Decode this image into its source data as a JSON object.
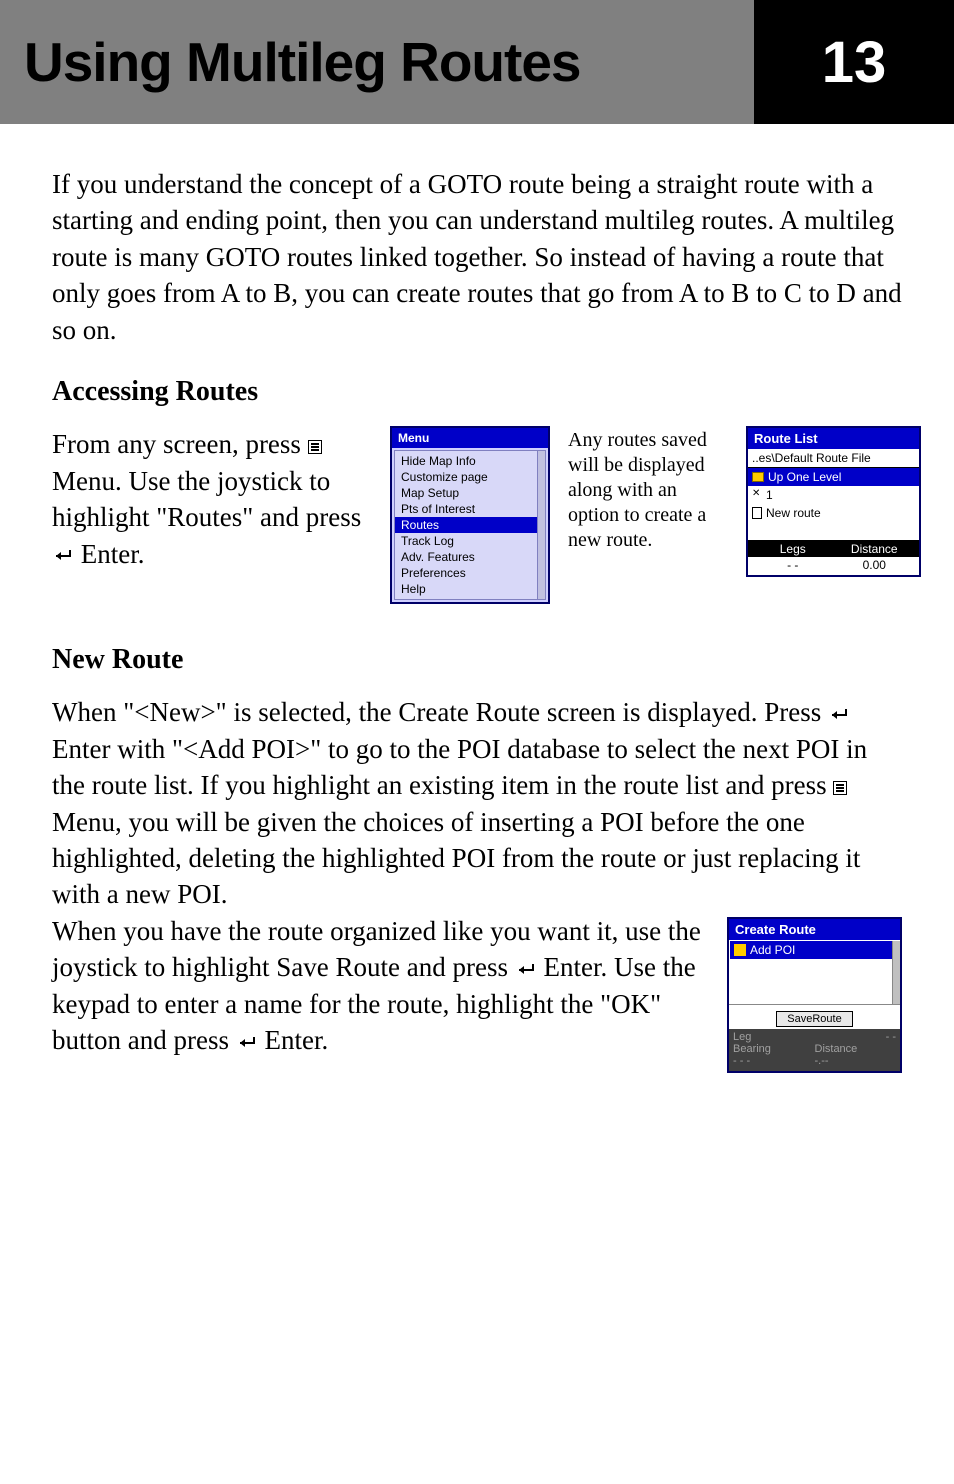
{
  "header": {
    "title": "Using Multileg Routes",
    "chapter": "13"
  },
  "intro": "If you understand the concept of a GOTO route being a straight route with a starting and ending point, then you can understand multileg routes.  A multileg route is many GOTO routes linked together.  So instead of having a route that only goes from A to B, you can create routes that go from A to B to C to D and so on.",
  "sections": {
    "accessing": {
      "title": "Accessing Routes",
      "text_prefix": "From any screen, press ",
      "text_mid1": " Menu.  Use the joystick to highlight \"Routes\" and press ",
      "text_suffix": " Enter.",
      "mid_caption": "Any routes saved will be displayed along with an option to create a new route."
    },
    "new_route": {
      "title": "New Route",
      "p1_a": "When \"<New>\" is selected, the Create Route screen is displayed. Press ",
      "p1_b": " Enter with \"<Add POI>\" to go to the POI database to select the next POI in the route list.  If you highlight an existing item in the route list and press ",
      "p1_c": " Menu, you will be given the choices of inserting a POI before the one highlighted, deleting the highlighted POI from the route or just replacing it with a new POI.",
      "p2_a": "When you have the route organized like you want it, use the joystick to highlight Save Route and press ",
      "p2_b": " Enter.  Use the keypad to enter a name for the route, highlight the \"OK\" button and press ",
      "p2_c": " Enter."
    }
  },
  "menu_shot": {
    "title": "Menu",
    "items": [
      "Hide Map Info",
      "Customize page",
      "Map Setup",
      "Pts of Interest",
      "Routes",
      "Track Log",
      "Adv. Features",
      "Preferences",
      "Help"
    ],
    "selected": "Routes"
  },
  "route_list_shot": {
    "title": "Route List",
    "path": "..es\\Default Route File",
    "up": "Up One Level",
    "items": [
      "1",
      "New route"
    ],
    "footer": {
      "legs_label": "Legs",
      "dist_label": "Distance",
      "legs_val": "- -",
      "dist_val": "0.00"
    }
  },
  "create_route_shot": {
    "title": "Create Route",
    "add_label": "Add POI",
    "save_label": "SaveRoute",
    "footer": {
      "leg": "Leg",
      "leg_val": "- -",
      "bearing": "Bearing",
      "distance": "Distance",
      "bearing_val": "- - -",
      "distance_val": "-.--"
    }
  }
}
